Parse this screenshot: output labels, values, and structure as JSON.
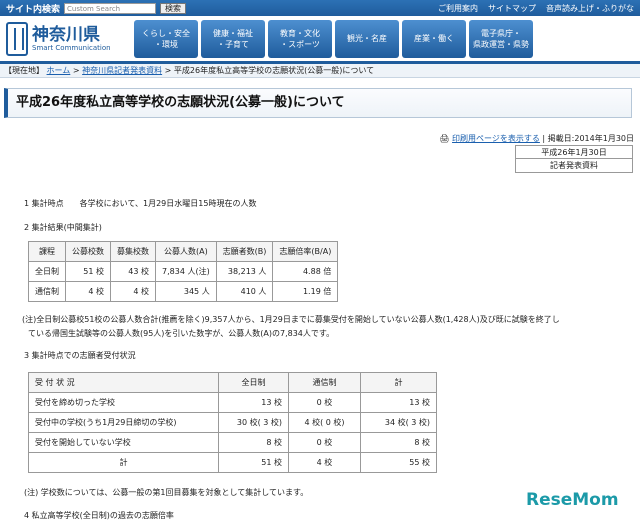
{
  "top": {
    "label": "サイト内検索",
    "search_placeholder": "Custom Search",
    "search_button": "検索",
    "links": [
      "ご利用案内",
      "サイトマップ",
      "音声読み上げ・ふりがな"
    ]
  },
  "logo": {
    "name": "神奈川県",
    "sub": "Smart Communication"
  },
  "nav": [
    "くらし・安全\n・環境",
    "健康・福祉\n・子育て",
    "教育・文化\n・スポーツ",
    "観光・名産",
    "産業・働く",
    "電子県庁・\n県政運営・県勢"
  ],
  "breadcrumb": {
    "current": "【現在地】",
    "home": "ホーム",
    "link": "神奈川県記者発表資料",
    "page": "平成26年度私立高等学校の志願状況(公募一般)について"
  },
  "title": "平成26年度私立高等学校の志願状況(公募一般)について",
  "print": {
    "link": "印刷用ページを表示する",
    "posted": "掲載日:2014年1月30日"
  },
  "date_box": [
    "平成26年1月30日",
    "記者発表資料"
  ],
  "s1": "1 集計時点　　各学校において、1月29日水曜日15時現在の人数",
  "s2": "2 集計結果(中間集計)",
  "t1": {
    "headers": [
      "課程",
      "公募校数",
      "募集校数",
      "公募人数(A)",
      "志願者数(B)",
      "志願倍率(B/A)"
    ],
    "rows": [
      [
        "全日制",
        "51 校",
        "43 校",
        "7,834 人(注)",
        "38,213 人",
        "4.88 倍"
      ],
      [
        "通信制",
        "4 校",
        "4 校",
        "345 人",
        "410 人",
        "1.19 倍"
      ]
    ]
  },
  "note1": "(注)全日制公募校51校の公募人数合計(推薦を除く)9,357人から、1月29日までに募集受付を開始していない公募人数(1,428人)及び既に試験を終了し",
  "note1b": "ている帰国生試験等の公募人数(95人)を引いた数字が、公募人数(A)の7,834人です。",
  "s3": "3 集計時点での志願者受付状況",
  "t2": {
    "headers": [
      "受 付 状 況",
      "全日制",
      "通信制",
      "計"
    ],
    "rows": [
      [
        "受付を締め切った学校",
        "13 校",
        "0 校",
        "13 校"
      ],
      [
        "受付中の学校(うち1月29日締切の学校)",
        "30 校( 3 校)",
        "4 校( 0 校)",
        "34 校( 3 校)"
      ],
      [
        "受付を開始していない学校",
        "8 校",
        "0 校",
        "8 校"
      ],
      [
        "計",
        "51 校",
        "4 校",
        "55 校"
      ]
    ]
  },
  "note2": "(注) 学校数については、公募一般の第1回目募集を対象として集計しています。",
  "s4": "4 私立高等学校(全日制)の過去の志願倍率",
  "watermark": "ReseMom"
}
